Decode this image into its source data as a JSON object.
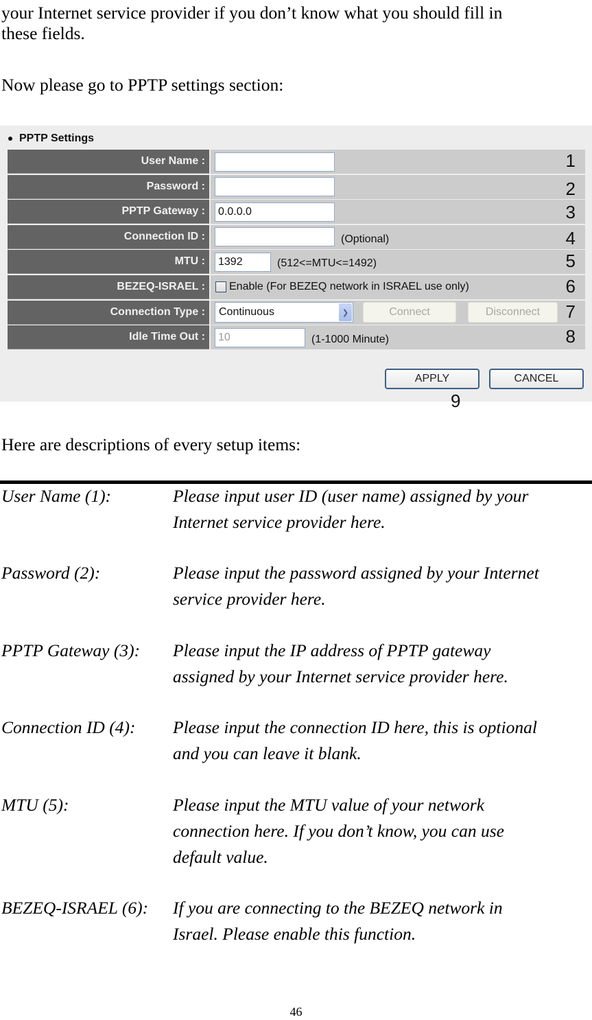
{
  "intro": {
    "line1": "your Internet service provider if you don’t know what you should fill in",
    "line2": "these fields.",
    "goto": "Now please go to PPTP settings section:"
  },
  "panel": {
    "title": "PPTP Settings",
    "rows": [
      {
        "label": "User Name :",
        "value": "",
        "marker": "1"
      },
      {
        "label": "Password :",
        "value": "",
        "marker": "2"
      },
      {
        "label": "PPTP Gateway :",
        "value": "0.0.0.0",
        "marker": "3"
      },
      {
        "label": "Connection ID :",
        "value": "",
        "hint": "(Optional)",
        "marker": "4"
      },
      {
        "label": "MTU :",
        "value": "1392",
        "hint": "(512<=MTU<=1492)",
        "marker": "5"
      },
      {
        "label": "BEZEQ-ISRAEL :",
        "checkbox_label": "Enable (For BEZEQ network in ISRAEL use only)",
        "checked": false,
        "marker": "6"
      },
      {
        "label": "Connection Type :",
        "selected": "Continuous",
        "connect": "Connect",
        "disconnect": "Disconnect",
        "marker": "7"
      },
      {
        "label": "Idle Time Out :",
        "value": "10",
        "hint": "(1-1000 Minute)",
        "marker": "8"
      }
    ],
    "apply": "APPLY",
    "cancel": "CANCEL",
    "marker9": "9"
  },
  "descriptions_intro": "Here are descriptions of every setup items:",
  "descriptions": [
    {
      "term": "User Name (1):",
      "lines": [
        "Please input user ID (user name) assigned by your",
        "Internet service provider here."
      ]
    },
    {
      "term": "Password (2):",
      "lines": [
        "Please input the password assigned by your Internet",
        "service provider here."
      ]
    },
    {
      "term": "PPTP Gateway (3):",
      "lines": [
        "Please input the IP address of PPTP gateway",
        "assigned by your Internet service provider here."
      ]
    },
    {
      "term": "Connection ID (4):",
      "lines": [
        "Please input the connection ID here, this is optional",
        "and you can leave it blank."
      ]
    },
    {
      "term": "MTU (5):",
      "lines": [
        "Please input the MTU value of your network",
        "connection here. If you don’t know, you can use",
        "default value."
      ]
    },
    {
      "term": "BEZEQ-ISRAEL (6):",
      "lines": [
        "If you are connecting to the BEZEQ network in",
        "Israel. Please enable this function."
      ]
    }
  ],
  "page_number": "46"
}
